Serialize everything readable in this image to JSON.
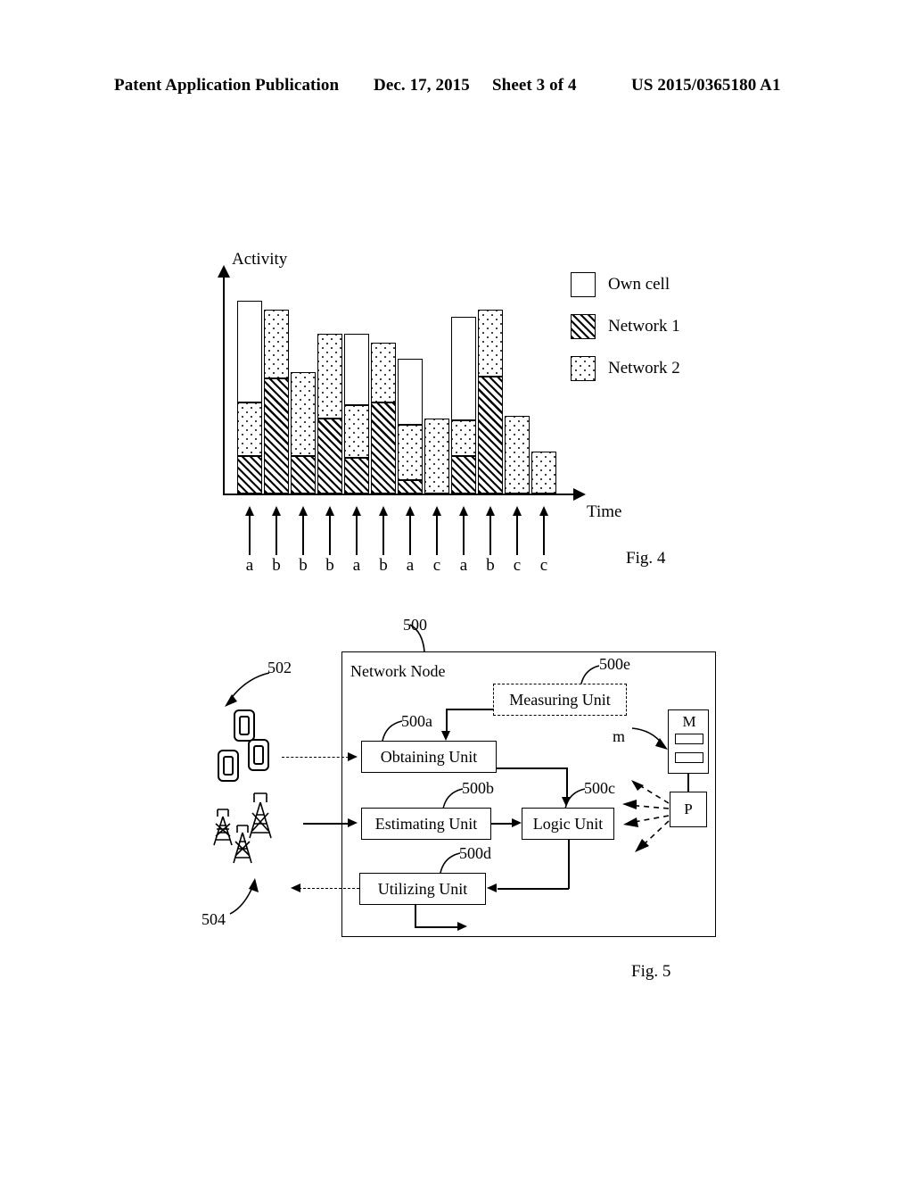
{
  "header": {
    "publication": "Patent Application Publication",
    "date": "Dec. 17, 2015",
    "sheet": "Sheet 3 of 4",
    "patent_number": "US 2015/0365180 A1"
  },
  "figure4": {
    "caption": "Fig. 4",
    "y_axis_label": "Activity",
    "x_axis_label": "Time",
    "ellipsis": "▪▪▪",
    "legend": [
      {
        "label": "Own cell",
        "pattern": "white"
      },
      {
        "label": "Network 1",
        "pattern": "hatch"
      },
      {
        "label": "Network 2",
        "pattern": "dots"
      }
    ],
    "tick_labels": [
      "a",
      "b",
      "b",
      "b",
      "a",
      "b",
      "a",
      "c",
      "a",
      "b",
      "c",
      "c"
    ]
  },
  "chart_data": {
    "type": "bar",
    "stacked": true,
    "title": "Activity",
    "xlabel": "Time",
    "ylabel": "Activity",
    "grid": false,
    "legend_position": "right",
    "axis_note": "Unitless relative activity; values read as fraction of plot height (0-100).",
    "ylim": [
      0,
      100
    ],
    "categories": [
      "a",
      "b",
      "b",
      "b",
      "a",
      "b",
      "a",
      "c",
      "a",
      "b",
      "c",
      "c"
    ],
    "series": [
      {
        "name": "Network 1",
        "pattern": "hatch",
        "values": [
          17,
          52,
          17,
          34,
          16,
          41,
          6,
          0,
          17,
          53,
          0,
          0
        ]
      },
      {
        "name": "Network 2",
        "pattern": "dots",
        "values": [
          24,
          31,
          38,
          38,
          24,
          27,
          25,
          34,
          16,
          30,
          35,
          19
        ]
      },
      {
        "name": "Own cell",
        "pattern": "white",
        "values": [
          46,
          0,
          0,
          0,
          32,
          0,
          30,
          0,
          47,
          0,
          0,
          0
        ]
      }
    ],
    "totals": [
      87,
      83,
      55,
      72,
      72,
      68,
      61,
      34,
      80,
      83,
      35,
      19
    ]
  },
  "figure5": {
    "caption": "Fig. 5",
    "node_title": "Network Node",
    "node_ref": "500",
    "units": [
      {
        "ref": "500e",
        "label": "Measuring Unit",
        "style": "dashed"
      },
      {
        "ref": "500a",
        "label": "Obtaining Unit",
        "style": "solid"
      },
      {
        "ref": "500b",
        "label": "Estimating Unit",
        "style": "solid"
      },
      {
        "ref": "500c",
        "label": "Logic Unit",
        "style": "solid"
      },
      {
        "ref": "500d",
        "label": "Utilizing Unit",
        "style": "solid"
      }
    ],
    "devices_ref": "502",
    "base_stations_ref": "504",
    "memory_label": "M",
    "processor_label": "P",
    "message_label": "m"
  }
}
